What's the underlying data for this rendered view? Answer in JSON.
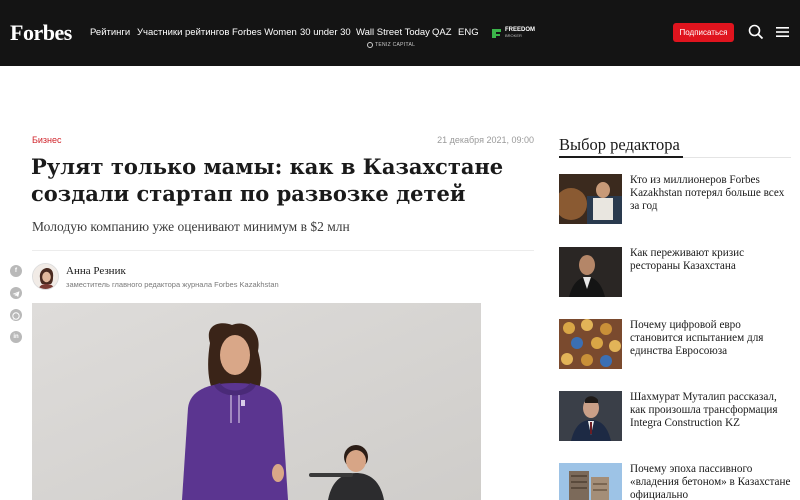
{
  "header": {
    "logo": "Forbes",
    "nav": [
      "Рейтинги",
      "Участники рейтингов",
      "Forbes Women",
      "30 under 30",
      "Wall Street Today",
      "QAZ",
      "ENG"
    ],
    "wst_sponsor": "TENIZ CAPITAL",
    "partner_line1": "FREEDOM",
    "partner_line2": "BROKER",
    "subscribe": "Подписаться",
    "accent_color": "#e0141e",
    "bar_color": "#141414"
  },
  "article": {
    "category": "Бизнес",
    "date": "21 декабря 2021, 09:00",
    "title": "Рулят только мамы: как в Казахстане создали стартап по развозке детей",
    "lead": "Молодую компанию уже оценивают минимум в $2 млн",
    "author_name": "Анна Резник",
    "author_role": "заместитель главного редактора журнала Forbes Kazakhstan"
  },
  "share": [
    "facebook-icon",
    "telegram-icon",
    "whatsapp-icon",
    "linkedin-icon"
  ],
  "sidebar": {
    "title": "Выбор редактора",
    "items": [
      {
        "text": "Кто из миллионеров Forbes Kazakhstan потерял больше всех за год"
      },
      {
        "text": "Как переживают кризис рестораны Казахстана"
      },
      {
        "text": "Почему цифровой евро становится испытанием для единства Евросоюза"
      },
      {
        "text": "Шахмурат Муталип рассказал, как произошла трансформация Integra Construction KZ"
      },
      {
        "text": "Почему эпоха пассивного «владения бетоном» в Казахстане официально"
      }
    ]
  }
}
